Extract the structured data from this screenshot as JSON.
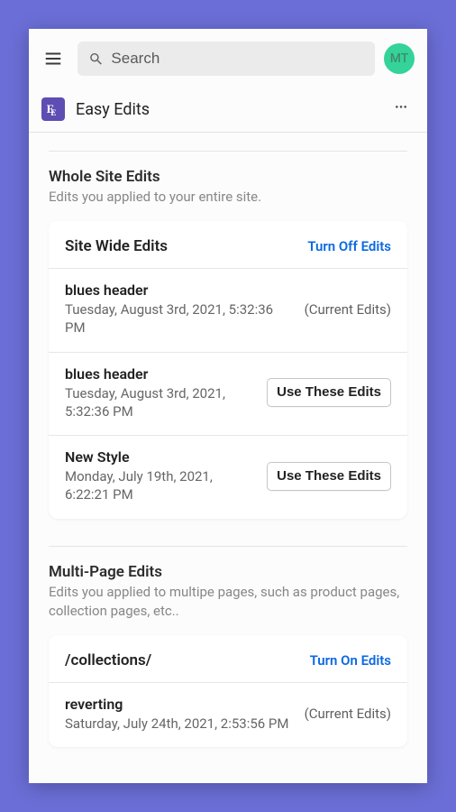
{
  "header": {
    "search_placeholder": "Search",
    "avatar_initials": "MT"
  },
  "appbar": {
    "title": "Easy Edits",
    "icon_label": "Eᴇ"
  },
  "sections": {
    "whole": {
      "title": "Whole Site Edits",
      "desc": "Edits you applied to your entire site."
    },
    "multi": {
      "title": "Multi-Page Edits",
      "desc": "Edits you applied to multipe pages, such as product pages, collection pages, etc.."
    }
  },
  "siteWide": {
    "card_title": "Site Wide Edits",
    "toggle_label": "Turn Off Edits",
    "current_label": "(Current Edits)",
    "button_label": "Use These Edits",
    "items": [
      {
        "name": "blues header",
        "date": "Tuesday, August 3rd, 2021, 5:32:36 PM",
        "current": true
      },
      {
        "name": "blues header",
        "date": "Tuesday, August 3rd, 2021, 5:32:36 PM",
        "current": false
      },
      {
        "name": "New Style",
        "date": "Monday, July 19th, 2021, 6:22:21 PM",
        "current": false
      }
    ]
  },
  "collections": {
    "card_title": "/collections/",
    "toggle_label": "Turn On Edits",
    "current_label": "(Current Edits)",
    "items": [
      {
        "name": "reverting",
        "date": "Saturday, July 24th, 2021, 2:53:56 PM",
        "current": true
      }
    ]
  }
}
